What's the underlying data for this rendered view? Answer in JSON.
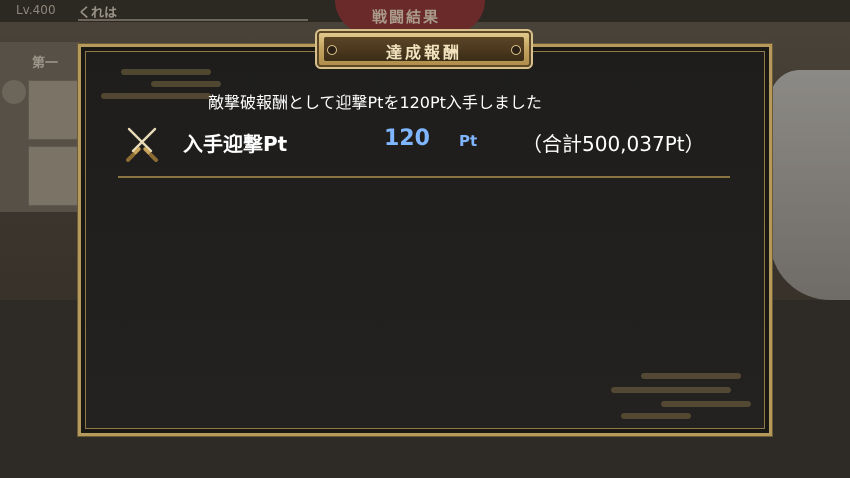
{
  "background": {
    "level": "Lv.400",
    "player_name": "くれは",
    "battle_result": "戦闘結果",
    "left_panel_title": "第一"
  },
  "dialog": {
    "title": "達成報酬",
    "message": "敵撃破報酬として迎撃Ptを120Pt入手しました",
    "reward": {
      "icon": "crossed-swords-icon",
      "label": "入手迎撃Pt",
      "value": "120",
      "unit": "Pt",
      "total": "（合計500,037Pt）"
    }
  },
  "colors": {
    "frame_gold": "#b59a5c",
    "value_blue": "#7fb6ff",
    "panel_bg": "#1e1d1c"
  }
}
